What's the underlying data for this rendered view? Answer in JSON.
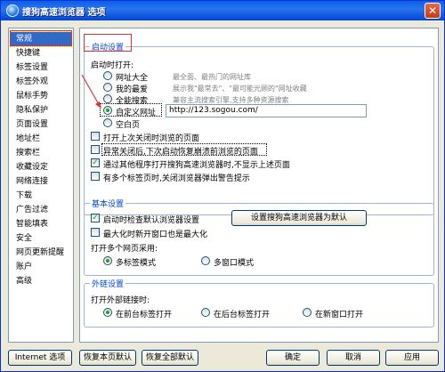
{
  "window": {
    "title": "搜狗高速浏览器 选项",
    "close_label": "✕"
  },
  "sidebar": {
    "items": [
      "常规",
      "快捷键",
      "标签设置",
      "标签外观",
      "鼠标手势",
      "隐私保护",
      "页面设置",
      "地址栏",
      "搜索栏",
      "收藏设定",
      "网络连接",
      "下载",
      "广告过滤",
      "智能填表",
      "安全",
      "网页更新提醒",
      "账户",
      "高级"
    ],
    "selected_index": 0
  },
  "startup": {
    "title": "启动设置",
    "open_on_start_label": "启动时打开:",
    "options": [
      {
        "label": "网址大全",
        "desc": "最全面、最热门的网址库",
        "selected": false
      },
      {
        "label": "我的最爱",
        "desc": "展示我\"最常去\"、\"最可能光顾的\"网址收藏",
        "selected": false
      },
      {
        "label": "全能搜索",
        "desc": "兼容主流搜索引擎,支持多种资源搜索",
        "selected": false
      },
      {
        "label": "自定义网址",
        "desc": "",
        "selected": true
      },
      {
        "label": "空白页",
        "desc": "",
        "selected": false
      }
    ],
    "custom_url": "http://123.sogou.com/",
    "checkboxes": [
      {
        "label": "打开上次关闭时浏览的页面",
        "checked": false
      },
      {
        "label": "异常关闭后,下次启动恢复崩溃前浏览的页面",
        "checked": false
      },
      {
        "label": "通过其他程序打开搜狗高速浏览器时,不显示上述页面",
        "checked": true
      },
      {
        "label": "有多个标签页时,关闭浏览器弹出警告提示",
        "checked": false
      }
    ]
  },
  "basic": {
    "title": "基本设置",
    "check_default_label": "启动时检查默认浏览器设置",
    "check_default_checked": true,
    "set_default_button": "设置搜狗高速浏览器为默认",
    "maximize_label": "最大化时新开窗口也是最大化",
    "maximize_checked": false,
    "multi_page_label": "打开多个网页采用:",
    "modes": [
      {
        "label": "多标签模式",
        "selected": true
      },
      {
        "label": "多窗口模式",
        "selected": false
      }
    ]
  },
  "external": {
    "title": "外链设置",
    "open_external_label": "打开外部链接时:",
    "options": [
      {
        "label": "在前台标签打开",
        "selected": true
      },
      {
        "label": "在后台标签打开",
        "selected": false
      },
      {
        "label": "在新窗口打开",
        "selected": false
      }
    ]
  },
  "footer": {
    "internet_options": "Internet 选项",
    "restore_page": "恢复本页默认",
    "restore_all": "恢复全部默认",
    "ok": "确定",
    "cancel": "取消",
    "apply": "应用"
  },
  "colors": {
    "accent": "#0046d5",
    "selection": "#316ac5",
    "annotation_red": "#e03030"
  }
}
